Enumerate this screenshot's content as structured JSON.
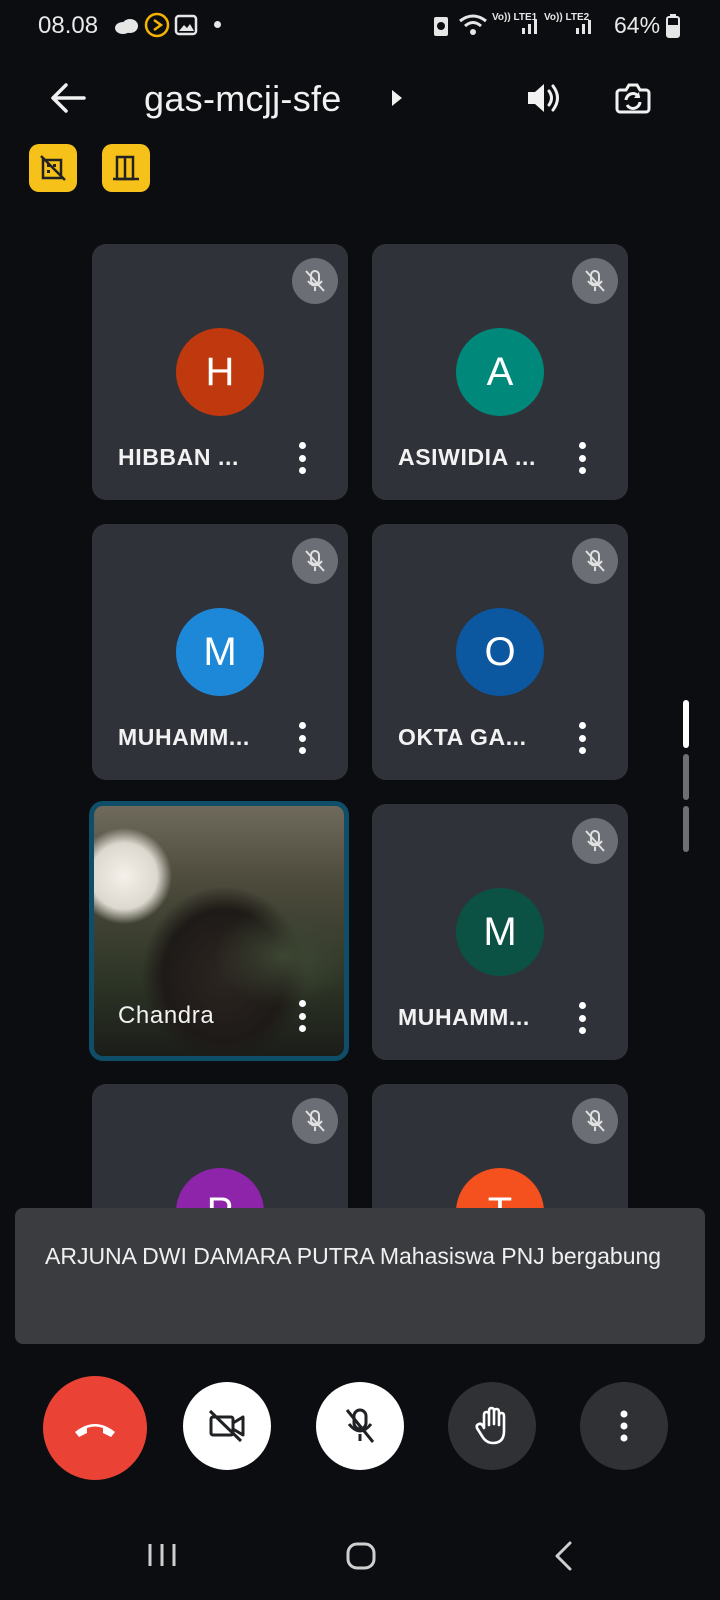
{
  "status_bar": {
    "time": "08.08",
    "battery": "64%",
    "sim1": "Vo)) LTE1",
    "sim2": "Vo)) LTE2"
  },
  "header": {
    "meeting_code": "gas-mcjj-sfe",
    "back_icon": "arrow-left-icon",
    "audio_icon": "speaker-icon",
    "switch_camera_icon": "switch-camera-icon"
  },
  "badges": [
    {
      "icon": "building-off-icon"
    },
    {
      "icon": "door-icon"
    }
  ],
  "participants": [
    {
      "name": "HIBBAN ...",
      "initial": "H",
      "color": "#c0390e",
      "muted": true
    },
    {
      "name": "ASIWIDIA ...",
      "initial": "A",
      "color": "#00897b",
      "muted": true
    },
    {
      "name": "MUHAMM...",
      "initial": "M",
      "color": "#1e88d8",
      "muted": true
    },
    {
      "name": "OKTA GA...",
      "initial": "O",
      "color": "#0b57a0",
      "muted": true
    },
    {
      "name": "Chandra",
      "initial": "",
      "video": true,
      "muted": false
    },
    {
      "name": "MUHAMM...",
      "initial": "M",
      "color": "#0b5144",
      "muted": true
    },
    {
      "name": "",
      "initial": "P",
      "color": "#8e24aa",
      "muted": true
    },
    {
      "name": "",
      "initial": "T",
      "color": "#f4511e",
      "muted": true
    }
  ],
  "toast": {
    "message": "ARJUNA DWI DAMARA PUTRA Mahasiswa PNJ bergabung"
  },
  "controls": [
    {
      "name": "end-call",
      "icon": "hang-up-icon",
      "color": "#ea4335"
    },
    {
      "name": "camera-off",
      "icon": "video-off-icon",
      "color": "#ffffff"
    },
    {
      "name": "mic-off",
      "icon": "mic-off-icon",
      "color": "#ffffff"
    },
    {
      "name": "raise-hand",
      "icon": "hand-icon",
      "color": "#2f3135"
    },
    {
      "name": "more-options",
      "icon": "more-vert-icon",
      "color": "#2f3135"
    }
  ],
  "nav_bar": {
    "recent_icon": "recent-apps-icon",
    "home_icon": "home-icon",
    "back_icon": "back-chevron-icon"
  }
}
